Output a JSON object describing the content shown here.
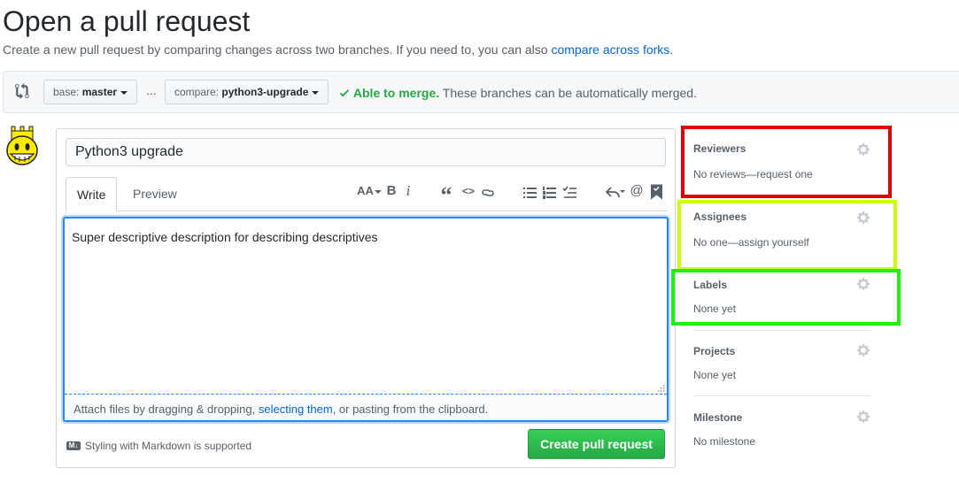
{
  "header": {
    "title": "Open a pull request",
    "subtitle_prefix": "Create a new pull request by comparing changes across two branches. If you need to, you can also ",
    "subtitle_link": "compare across forks",
    "subtitle_suffix": "."
  },
  "range": {
    "base_label": "base:",
    "base_value": "master",
    "ellipsis": "...",
    "compare_label": "compare:",
    "compare_value": "python3-upgrade",
    "merge_status_strong": "Able to merge.",
    "merge_status_text": "These branches can be automatically merged."
  },
  "form": {
    "title_value": "Python3 upgrade",
    "tab_write": "Write",
    "tab_preview": "Preview",
    "toolbar": {
      "header": "AA",
      "bold": "B",
      "italic": "i",
      "quote": "“",
      "code": "<>",
      "mention": "@"
    },
    "body_value": "Super descriptive description for describing descriptives",
    "attach_prefix": "Attach files by dragging & dropping, ",
    "attach_link": "selecting them",
    "attach_suffix": ", or pasting from the clipboard.",
    "markdown_note": "Styling with Markdown is supported",
    "markdown_icon_label": "M↓",
    "submit_label": "Create pull request"
  },
  "sidebar": {
    "reviewers": {
      "heading": "Reviewers",
      "value": "No reviews—request one"
    },
    "assignees": {
      "heading": "Assignees",
      "value": "No one—assign yourself"
    },
    "labels": {
      "heading": "Labels",
      "value": "None yet"
    },
    "projects": {
      "heading": "Projects",
      "value": "None yet"
    },
    "milestone": {
      "heading": "Milestone",
      "value": "No milestone"
    }
  },
  "colors": {
    "link": "#0366d6",
    "success": "#28a745",
    "focus": "#2188ff",
    "highlight_red": "#e00000",
    "highlight_yellow": "#ccff00",
    "highlight_green": "#22ee11"
  },
  "icons": [
    "compare-icon",
    "caret-down-icon",
    "check-icon",
    "avatar-icon",
    "header-icon",
    "bold-icon",
    "italic-icon",
    "quote-icon",
    "code-icon",
    "link-icon",
    "unordered-list-icon",
    "ordered-list-icon",
    "task-list-icon",
    "reply-icon",
    "mention-icon",
    "bookmark-icon",
    "markdown-icon",
    "gear-icon"
  ]
}
